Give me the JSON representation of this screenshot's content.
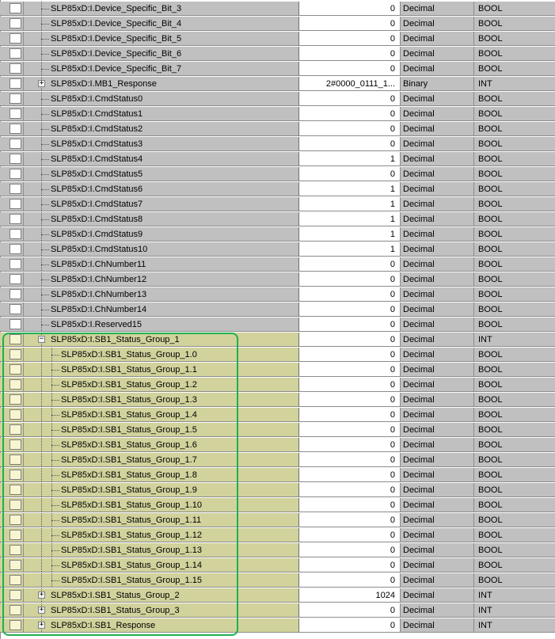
{
  "rows": [
    {
      "name": "SLP85xD:I.Device_Specific_Bit_3",
      "value": "0",
      "style": "Decimal",
      "type": "BOOL",
      "level": 1
    },
    {
      "name": "SLP85xD:I.Device_Specific_Bit_4",
      "value": "0",
      "style": "Decimal",
      "type": "BOOL",
      "level": 1
    },
    {
      "name": "SLP85xD:I.Device_Specific_Bit_5",
      "value": "0",
      "style": "Decimal",
      "type": "BOOL",
      "level": 1
    },
    {
      "name": "SLP85xD:I.Device_Specific_Bit_6",
      "value": "0",
      "style": "Decimal",
      "type": "BOOL",
      "level": 1
    },
    {
      "name": "SLP85xD:I.Device_Specific_Bit_7",
      "value": "0",
      "style": "Decimal",
      "type": "BOOL",
      "level": 1
    },
    {
      "name": "SLP85xD:I.MB1_Response",
      "value": "2#0000_0111_1...",
      "style": "Binary",
      "type": "INT",
      "level": 1,
      "expander": "+"
    },
    {
      "name": "SLP85xD:I.CmdStatus0",
      "value": "0",
      "style": "Decimal",
      "type": "BOOL",
      "level": 1
    },
    {
      "name": "SLP85xD:I.CmdStatus1",
      "value": "0",
      "style": "Decimal",
      "type": "BOOL",
      "level": 1
    },
    {
      "name": "SLP85xD:I.CmdStatus2",
      "value": "0",
      "style": "Decimal",
      "type": "BOOL",
      "level": 1
    },
    {
      "name": "SLP85xD:I.CmdStatus3",
      "value": "0",
      "style": "Decimal",
      "type": "BOOL",
      "level": 1
    },
    {
      "name": "SLP85xD:I.CmdStatus4",
      "value": "1",
      "style": "Decimal",
      "type": "BOOL",
      "level": 1
    },
    {
      "name": "SLP85xD:I.CmdStatus5",
      "value": "0",
      "style": "Decimal",
      "type": "BOOL",
      "level": 1
    },
    {
      "name": "SLP85xD:I.CmdStatus6",
      "value": "1",
      "style": "Decimal",
      "type": "BOOL",
      "level": 1
    },
    {
      "name": "SLP85xD:I.CmdStatus7",
      "value": "1",
      "style": "Decimal",
      "type": "BOOL",
      "level": 1
    },
    {
      "name": "SLP85xD:I.CmdStatus8",
      "value": "1",
      "style": "Decimal",
      "type": "BOOL",
      "level": 1
    },
    {
      "name": "SLP85xD:I.CmdStatus9",
      "value": "1",
      "style": "Decimal",
      "type": "BOOL",
      "level": 1
    },
    {
      "name": "SLP85xD:I.CmdStatus10",
      "value": "1",
      "style": "Decimal",
      "type": "BOOL",
      "level": 1
    },
    {
      "name": "SLP85xD:I.ChNumber11",
      "value": "0",
      "style": "Decimal",
      "type": "BOOL",
      "level": 1
    },
    {
      "name": "SLP85xD:I.ChNumber12",
      "value": "0",
      "style": "Decimal",
      "type": "BOOL",
      "level": 1
    },
    {
      "name": "SLP85xD:I.ChNumber13",
      "value": "0",
      "style": "Decimal",
      "type": "BOOL",
      "level": 1
    },
    {
      "name": "SLP85xD:I.ChNumber14",
      "value": "0",
      "style": "Decimal",
      "type": "BOOL",
      "level": 1
    },
    {
      "name": "SLP85xD:I.Reserved15",
      "value": "0",
      "style": "Decimal",
      "type": "BOOL",
      "level": 1
    },
    {
      "name": "SLP85xD:I.SB1_Status_Group_1",
      "value": "0",
      "style": "Decimal",
      "type": "INT",
      "level": 1,
      "expander": "−",
      "highlight": true
    },
    {
      "name": "SLP85xD:I.SB1_Status_Group_1.0",
      "value": "0",
      "style": "Decimal",
      "type": "BOOL",
      "level": 2,
      "highlight": true
    },
    {
      "name": "SLP85xD:I.SB1_Status_Group_1.1",
      "value": "0",
      "style": "Decimal",
      "type": "BOOL",
      "level": 2,
      "highlight": true
    },
    {
      "name": "SLP85xD:I.SB1_Status_Group_1.2",
      "value": "0",
      "style": "Decimal",
      "type": "BOOL",
      "level": 2,
      "highlight": true
    },
    {
      "name": "SLP85xD:I.SB1_Status_Group_1.3",
      "value": "0",
      "style": "Decimal",
      "type": "BOOL",
      "level": 2,
      "highlight": true
    },
    {
      "name": "SLP85xD:I.SB1_Status_Group_1.4",
      "value": "0",
      "style": "Decimal",
      "type": "BOOL",
      "level": 2,
      "highlight": true
    },
    {
      "name": "SLP85xD:I.SB1_Status_Group_1.5",
      "value": "0",
      "style": "Decimal",
      "type": "BOOL",
      "level": 2,
      "highlight": true
    },
    {
      "name": "SLP85xD:I.SB1_Status_Group_1.6",
      "value": "0",
      "style": "Decimal",
      "type": "BOOL",
      "level": 2,
      "highlight": true
    },
    {
      "name": "SLP85xD:I.SB1_Status_Group_1.7",
      "value": "0",
      "style": "Decimal",
      "type": "BOOL",
      "level": 2,
      "highlight": true
    },
    {
      "name": "SLP85xD:I.SB1_Status_Group_1.8",
      "value": "0",
      "style": "Decimal",
      "type": "BOOL",
      "level": 2,
      "highlight": true
    },
    {
      "name": "SLP85xD:I.SB1_Status_Group_1.9",
      "value": "0",
      "style": "Decimal",
      "type": "BOOL",
      "level": 2,
      "highlight": true
    },
    {
      "name": "SLP85xD:I.SB1_Status_Group_1.10",
      "value": "0",
      "style": "Decimal",
      "type": "BOOL",
      "level": 2,
      "highlight": true
    },
    {
      "name": "SLP85xD:I.SB1_Status_Group_1.11",
      "value": "0",
      "style": "Decimal",
      "type": "BOOL",
      "level": 2,
      "highlight": true
    },
    {
      "name": "SLP85xD:I.SB1_Status_Group_1.12",
      "value": "0",
      "style": "Decimal",
      "type": "BOOL",
      "level": 2,
      "highlight": true
    },
    {
      "name": "SLP85xD:I.SB1_Status_Group_1.13",
      "value": "0",
      "style": "Decimal",
      "type": "BOOL",
      "level": 2,
      "highlight": true
    },
    {
      "name": "SLP85xD:I.SB1_Status_Group_1.14",
      "value": "0",
      "style": "Decimal",
      "type": "BOOL",
      "level": 2,
      "highlight": true
    },
    {
      "name": "SLP85xD:I.SB1_Status_Group_1.15",
      "value": "0",
      "style": "Decimal",
      "type": "BOOL",
      "level": 2,
      "highlight": true
    },
    {
      "name": "SLP85xD:I.SB1_Status_Group_2",
      "value": "1024",
      "style": "Decimal",
      "type": "INT",
      "level": 1,
      "expander": "+",
      "highlight": true
    },
    {
      "name": "SLP85xD:I.SB1_Status_Group_3",
      "value": "0",
      "style": "Decimal",
      "type": "INT",
      "level": 1,
      "expander": "+",
      "highlight": true
    },
    {
      "name": "SLP85xD:I.SB1_Response",
      "value": "0",
      "style": "Decimal",
      "type": "INT",
      "level": 1,
      "expander": "+",
      "highlight": true
    }
  ],
  "colors": {
    "highlight_border": "#20b050",
    "highlight_fill": "#d1d29c",
    "row_gray": "#c0c0c0"
  }
}
